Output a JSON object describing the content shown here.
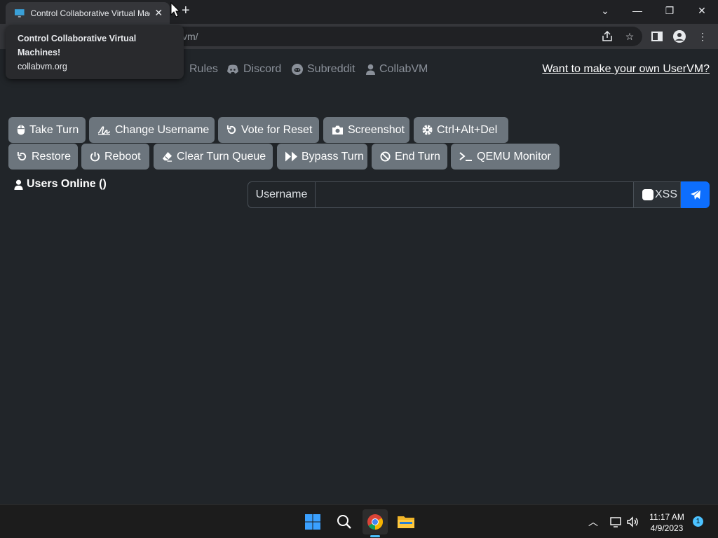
{
  "browser": {
    "tab_title": "Control Collaborative Virtual Machines!",
    "url_fragment": "vm/",
    "tooltip": {
      "title": "Control Collaborative Virtual Machines!",
      "url": "collabvm.org"
    }
  },
  "nav": {
    "rules": "Rules",
    "discord": "Discord",
    "subreddit": "Subreddit",
    "collabvm": "CollabVM",
    "own_uservm": "Want to make your own UserVM?"
  },
  "buttons": {
    "take_turn": "Take Turn",
    "change_username": "Change Username",
    "vote_reset": "Vote for Reset",
    "screenshot": "Screenshot",
    "ctrl_alt_del": "Ctrl+Alt+Del",
    "restore": "Restore",
    "reboot": "Reboot",
    "clear_queue": "Clear Turn Queue",
    "bypass_turn": "Bypass Turn",
    "end_turn": "End Turn",
    "qemu_monitor": "QEMU Monitor"
  },
  "users": {
    "label": "Users Online ()"
  },
  "chat": {
    "username_label": "Username",
    "input_value": "",
    "xss_label": "XSS"
  },
  "taskbar": {
    "time": "11:17 AM",
    "date": "4/9/2023",
    "notification_count": "1"
  },
  "colors": {
    "page_bg": "#212529",
    "button_bg": "#6c757d",
    "send_button": "#0d6efd"
  }
}
